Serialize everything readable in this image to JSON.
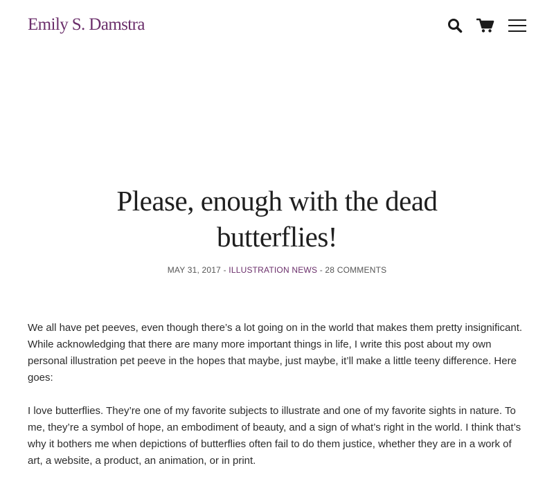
{
  "header": {
    "logo": "Emily S. Damstra",
    "icons": [
      "search-icon",
      "cart-icon",
      "menu-icon"
    ]
  },
  "post": {
    "title": "Please, enough with the dead butterflies!",
    "date": "May 31, 2017",
    "separator": " - ",
    "category": "Illustration News",
    "comments": "28 Comments",
    "paragraphs": [
      "We all have pet peeves, even though there’s a lot going on in the world that makes them pretty insignificant. While acknowledging that there are many more important things in life, I write this post about my own personal illustration pet peeve in the hopes that maybe, just maybe, it’ll make a little teeny difference. Here goes:",
      "I love butterflies. They’re one of my favorite subjects to illustrate and one of my favorite sights in nature. To me, they’re a symbol of hope, an embodiment of beauty, and a sign of what’s right in the world. I think that’s why it bothers me when depictions of butterflies often fail to do them justice, whether they are in a work of art, a website, a product, an animation, or in print."
    ]
  },
  "colors": {
    "accent": "#6b2f6b",
    "text": "#2b2b2b",
    "icon": "#1a1a1a"
  }
}
